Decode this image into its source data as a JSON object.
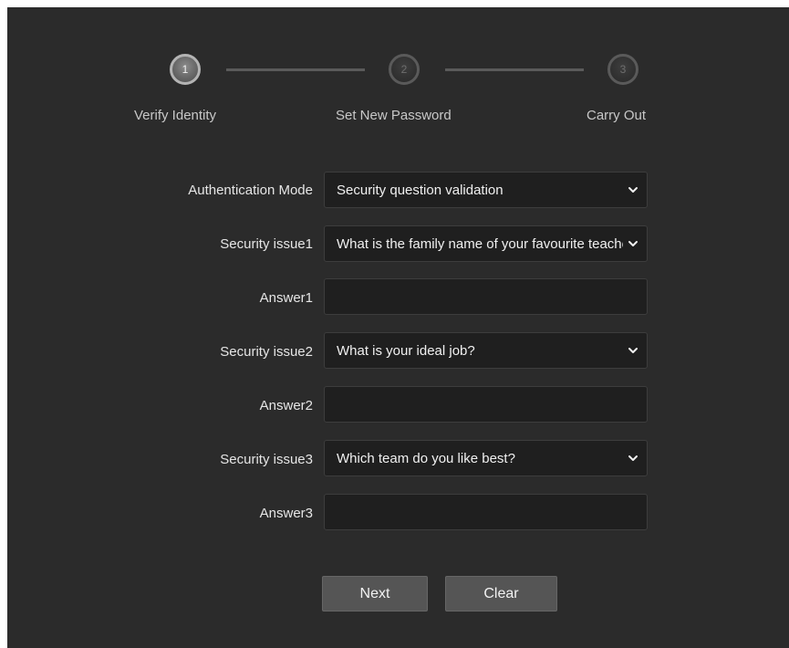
{
  "stepper": {
    "steps": [
      {
        "number": "1",
        "label": "Verify Identity",
        "state": "active"
      },
      {
        "number": "2",
        "label": "Set New Password",
        "state": "inactive"
      },
      {
        "number": "3",
        "label": "Carry Out",
        "state": "inactive"
      }
    ]
  },
  "form": {
    "auth_mode": {
      "label": "Authentication Mode",
      "value": "Security question validation"
    },
    "question1": {
      "label": "Security issue1",
      "value": "What is the family name of your favourite teacher?"
    },
    "answer1": {
      "label": "Answer1",
      "value": ""
    },
    "question2": {
      "label": "Security issue2",
      "value": "What is your ideal job?"
    },
    "answer2": {
      "label": "Answer2",
      "value": ""
    },
    "question3": {
      "label": "Security issue3",
      "value": "Which team do you like best?"
    },
    "answer3": {
      "label": "Answer3",
      "value": ""
    }
  },
  "buttons": {
    "next_label": "Next",
    "clear_label": "Clear"
  },
  "icons": {
    "select_arrow": "chevron-down-icon"
  },
  "colors": {
    "panel_bg": "#2b2b2b",
    "field_bg": "#1f1f1f",
    "button_bg": "#555555",
    "text": "#e6e6e6"
  }
}
